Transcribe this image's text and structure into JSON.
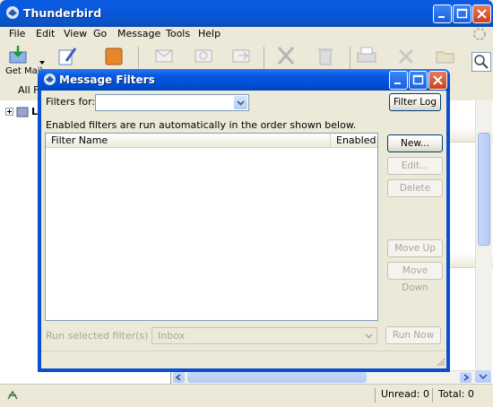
{
  "window": {
    "title": "Thunderbird"
  },
  "menu": [
    "File",
    "Edit",
    "View",
    "Go",
    "Message",
    "Tools",
    "Help"
  ],
  "toolbar": {
    "get_mail_label": "Get Mail"
  },
  "folder_pane": {
    "header": "All Fo",
    "root_folder": "Lo"
  },
  "status": {
    "unread": "Unread: 0",
    "total": "Total: 0"
  },
  "dialog": {
    "title": "Message Filters",
    "filters_for_label": "Filters for:",
    "filters_for_value": "",
    "filter_log_button": "Filter Log",
    "description": "Enabled filters are run automatically in the order shown below.",
    "columns": [
      "Filter Name",
      "Enabled"
    ],
    "buttons": {
      "new": "New...",
      "edit": "Edit...",
      "delete": "Delete",
      "move_up": "Move Up",
      "move_down": "Move Down",
      "run_now": "Run Now"
    },
    "run_label": "Run selected filter(s) on:",
    "run_folder": "Inbox"
  },
  "colors": {
    "title_blue": "#0a5be0",
    "face": "#ece9d8",
    "close_red": "#c7411d"
  }
}
